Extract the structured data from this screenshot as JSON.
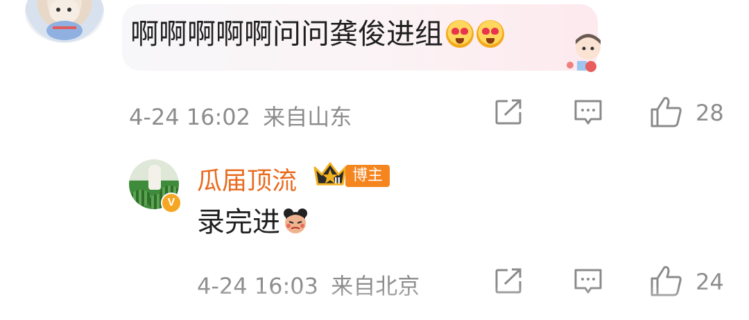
{
  "comment": {
    "text": "啊啊啊啊啊问问龚俊进组",
    "emojis": [
      "heart-eyes-emoji",
      "heart-eyes-emoji"
    ],
    "timestamp": "4-24 16:02",
    "location": "来自山东",
    "like_count": "28"
  },
  "reply": {
    "username": "瓜届顶流",
    "level_badge": "II",
    "role_badge": "博主",
    "verified_mark": "V",
    "text": "录完进",
    "emoji": "cartoon-face-emoji",
    "timestamp": "4-24 16:03",
    "location": "来自北京",
    "like_count": "24"
  },
  "icons": {
    "share": "share-icon",
    "comment": "comment-icon",
    "like": "thumbs-up-icon"
  },
  "colors": {
    "username": "#e86b1f",
    "badge_bg": "#f5851f",
    "meta_text": "#8c8c8c",
    "verified": "#f5a623"
  }
}
